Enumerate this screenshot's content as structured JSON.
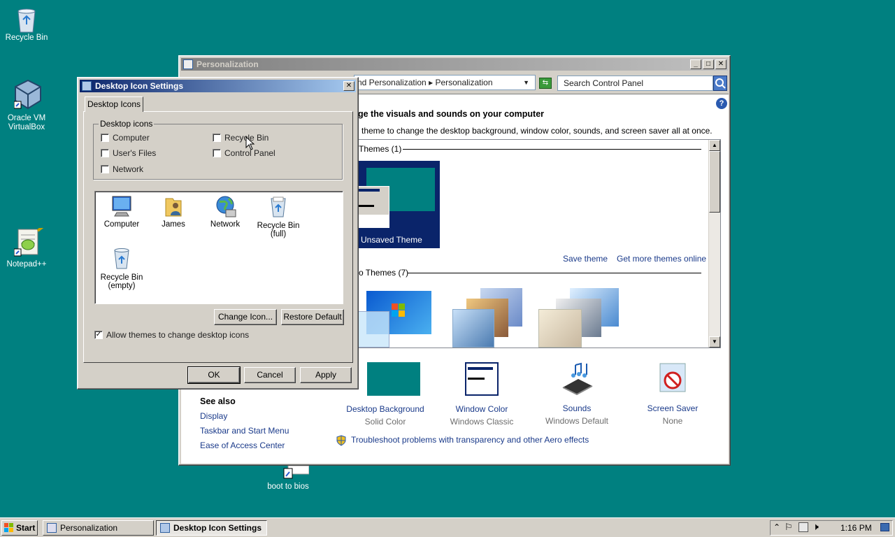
{
  "desktop": {
    "icons": [
      {
        "label": "Recycle Bin"
      },
      {
        "label": "Oracle VM VirtualBox"
      },
      {
        "label": "Notepad++"
      },
      {
        "label": "boot to bios"
      }
    ]
  },
  "personalization": {
    "title": "Personalization",
    "breadcrumb": "nd Personalization",
    "breadcrumb_current": "Personalization",
    "search_placeholder": "Search Control Panel",
    "heading": "ge the visuals and sounds on your computer",
    "subheading": "theme to change the desktop background, window color, sounds, and screen saver all at once.",
    "my_themes": "Themes (1)",
    "unsaved_theme": "Unsaved Theme",
    "save_theme": "Save theme",
    "get_more_themes": "Get more themes online",
    "aero_themes": "o Themes (7)",
    "settings": [
      {
        "label": "Desktop Background",
        "value": "Solid Color"
      },
      {
        "label": "Window Color",
        "value": "Windows Classic"
      },
      {
        "label": "Sounds",
        "value": "Windows Default"
      },
      {
        "label": "Screen Saver",
        "value": "None"
      }
    ],
    "see_also": {
      "title": "See also",
      "links": [
        "Display",
        "Taskbar and Start Menu",
        "Ease of Access Center"
      ]
    },
    "troubleshoot": "Troubleshoot problems with transparency and other Aero effects"
  },
  "dialog": {
    "title": "Desktop Icon Settings",
    "tab": "Desktop Icons",
    "group_label": "Desktop icons",
    "checkboxes": [
      {
        "label": "Computer",
        "checked": false
      },
      {
        "label": "Recycle Bin",
        "checked": false
      },
      {
        "label": "User's Files",
        "checked": false
      },
      {
        "label": "Control Panel",
        "checked": false
      },
      {
        "label": "Network",
        "checked": false
      }
    ],
    "icons": [
      {
        "label": "Computer"
      },
      {
        "label": "James"
      },
      {
        "label": "Network"
      },
      {
        "label": "Recycle Bin (full)"
      },
      {
        "label": "Recycle Bin (empty)"
      }
    ],
    "change_icon": "Change Icon...",
    "restore_default": "Restore Default",
    "allow_themes": "Allow themes to change desktop icons",
    "allow_themes_checked": true,
    "ok": "OK",
    "cancel": "Cancel",
    "apply": "Apply"
  },
  "taskbar": {
    "start": "Start",
    "tasks": [
      {
        "label": "Personalization",
        "active": false
      },
      {
        "label": "Desktop Icon Settings",
        "active": true
      }
    ],
    "clock": "1:16 PM"
  }
}
